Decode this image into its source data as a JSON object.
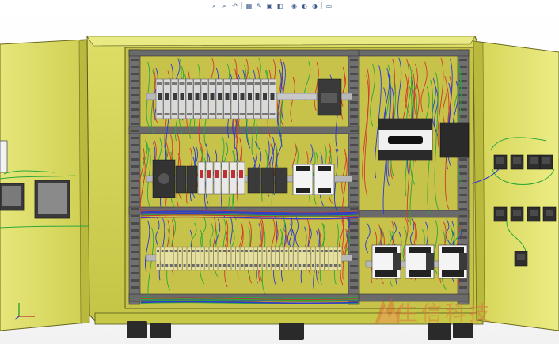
{
  "app": {
    "title": ""
  },
  "toolbar": {
    "buttons": [
      {
        "name": "zoom-to-fit-icon",
        "glyph": "⌕"
      },
      {
        "name": "zoom-to-area-icon",
        "glyph": "⌕"
      },
      {
        "name": "previous-view-icon",
        "glyph": "↶"
      },
      {
        "name": "section-view-icon",
        "glyph": "▦"
      },
      {
        "name": "dynamic-annotation-icon",
        "glyph": "✎"
      },
      {
        "name": "view-orientation-icon",
        "glyph": "▣"
      },
      {
        "name": "display-style-icon",
        "glyph": "◧"
      },
      {
        "name": "hide-show-items-icon",
        "glyph": "◉"
      },
      {
        "name": "edit-appearance-icon",
        "glyph": "◐"
      },
      {
        "name": "apply-scene-icon",
        "glyph": "◑"
      },
      {
        "name": "view-settings-icon",
        "glyph": "▭"
      }
    ]
  },
  "watermark": {
    "text": "生信科技"
  },
  "colors": {
    "cabinet": "#d8d85a",
    "cabinet_dark": "#b8b83a",
    "mounting_plate": "#c8c24a",
    "door": "#e0e070",
    "duct": "#6e6e6e",
    "breaker": "#d9d9d9",
    "terminal": "#e6e0a0",
    "contactor_white": "#f4f4f4",
    "wire_red": "#d23a2a",
    "wire_blue": "#2a3ad2",
    "wire_green": "#2aa83a",
    "feet": "#2a2a2a"
  }
}
